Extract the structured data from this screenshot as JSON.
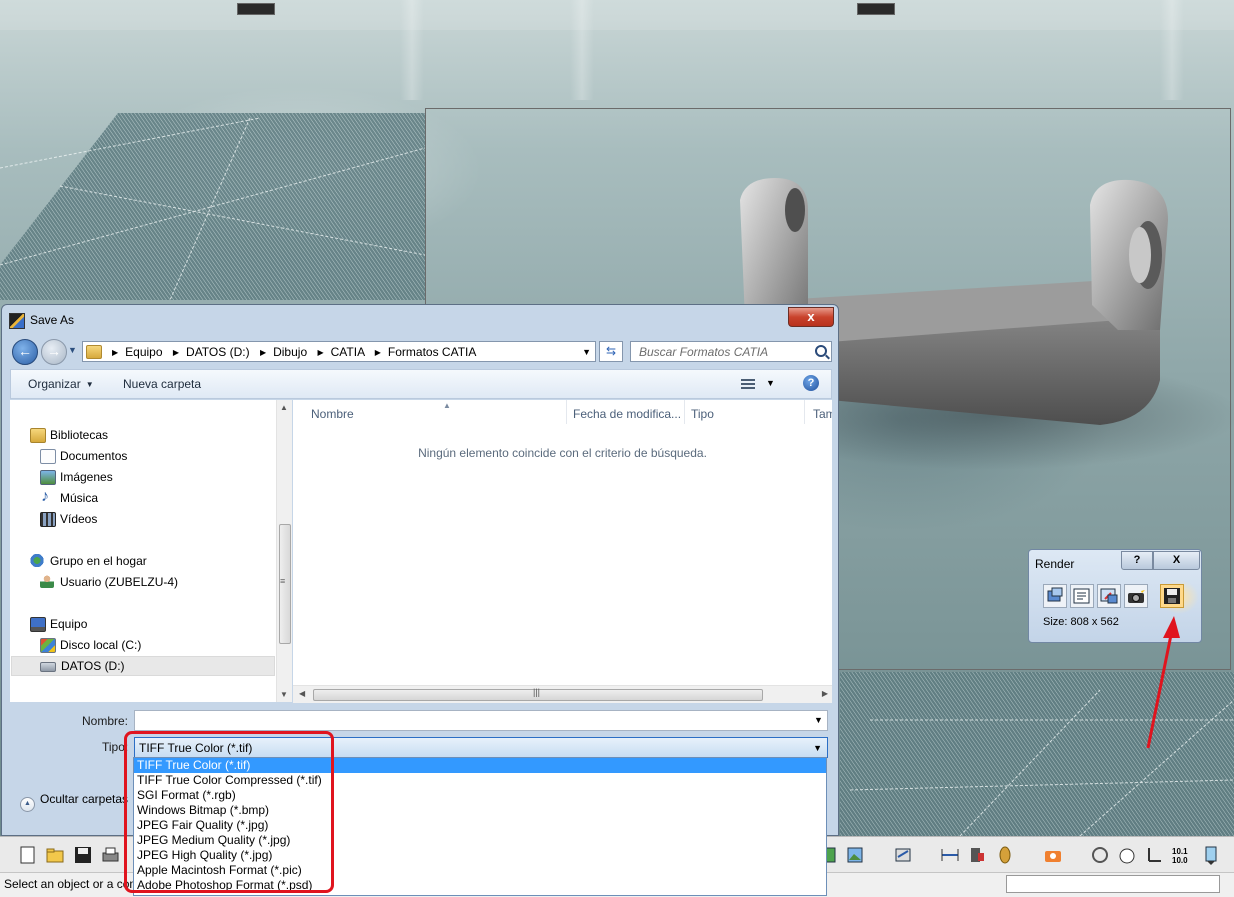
{
  "save_dialog": {
    "title": "Save As",
    "close_label": "x",
    "address_crumbs": [
      "Equipo",
      "DATOS (D:)",
      "Dibujo",
      "CATIA",
      "Formatos CATIA"
    ],
    "search_placeholder": "Buscar Formatos CATIA",
    "toolbar": {
      "organize": "Organizar",
      "new_folder": "Nueva carpeta",
      "help": "?"
    },
    "nav_tree": [
      {
        "label": "Bibliotecas",
        "icon": "library-icon"
      },
      {
        "label": "Documentos",
        "icon": "documents-icon"
      },
      {
        "label": "Imágenes",
        "icon": "pictures-icon"
      },
      {
        "label": "Música",
        "icon": "music-icon"
      },
      {
        "label": "Vídeos",
        "icon": "videos-icon"
      },
      {
        "label": "Grupo en el hogar",
        "icon": "homegroup-icon"
      },
      {
        "label": "Usuario (ZUBELZU-4)",
        "icon": "user-icon"
      },
      {
        "label": "Equipo",
        "icon": "computer-icon"
      },
      {
        "label": "Disco local (C:)",
        "icon": "local-disk-icon"
      },
      {
        "label": "DATOS (D:)",
        "icon": "drive-icon"
      }
    ],
    "columns": [
      "Nombre",
      "Fecha de modifica...",
      "Tipo",
      "Tam"
    ],
    "empty_message": "Ningún elemento coincide con el criterio de búsqueda.",
    "filename_label": "Nombre:",
    "filename_value": "",
    "type_label": "Tipo:",
    "type_value": "TIFF True Color (*.tif)",
    "type_options": [
      "TIFF True Color (*.tif)",
      "TIFF True Color Compressed (*.tif)",
      "SGI Format (*.rgb)",
      "Windows Bitmap (*.bmp)",
      "JPEG Fair Quality (*.jpg)",
      "JPEG Medium Quality (*.jpg)",
      "JPEG High Quality (*.jpg)",
      "Apple Macintosh Format (*.pic)",
      "Adobe Photoshop Format (*.psd)"
    ],
    "hide_folders": "Ocultar carpetas"
  },
  "render_panel": {
    "title": "Render",
    "help_label": "?",
    "close_label": "X",
    "size_text": "Size: 808 x 562",
    "tools": [
      "render-icon",
      "render-options-icon",
      "render-window-icon",
      "render-shooting-icon",
      "save-render-icon"
    ]
  },
  "status": {
    "text": "Select an object or a com"
  },
  "colors": {
    "highlight": "#e0141e",
    "selection": "#3399ff",
    "arrow": "#e0141e"
  }
}
